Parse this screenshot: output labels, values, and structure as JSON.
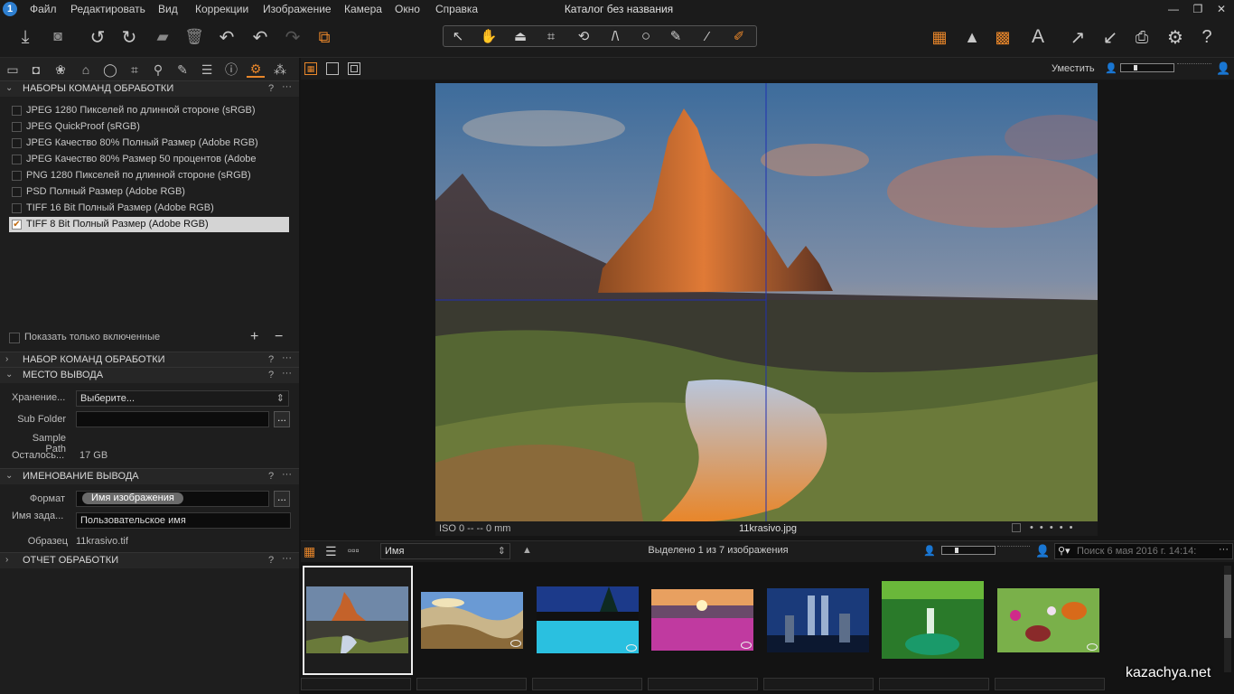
{
  "window": {
    "title": "Каталог без названия"
  },
  "menu": [
    "Файл",
    "Редактировать",
    "Вид",
    "Коррекции",
    "Изображение",
    "Камера",
    "Окно",
    "Справка"
  ],
  "window_controls": [
    "—",
    "❐",
    "✕"
  ],
  "app_icon": "1",
  "toolbar": {
    "left_icons": [
      "import-icon",
      "camera-icon",
      "rotate-left-icon",
      "rotate-right-icon",
      "move-to-icon",
      "trash-icon",
      "undo-all-icon",
      "undo-icon",
      "redo-icon",
      "variants-icon"
    ],
    "cursor_tools": [
      "select-icon",
      "pan-icon",
      "loupe-icon",
      "crop-icon",
      "rotate-icon",
      "keystone-icon",
      "spot-icon",
      "brush-icon",
      "picker-icon",
      "color-picker-icon"
    ],
    "right_icons": [
      "grid-overlay-icon",
      "warning-icon",
      "focus-mask-icon",
      "text-icon",
      "export-icon",
      "import-arrow-icon",
      "print-icon",
      "settings-icon",
      "help-icon"
    ]
  },
  "tooltabs": [
    "folder",
    "camera",
    "color",
    "exposure",
    "lens",
    "crop",
    "loupe",
    "brush",
    "meta",
    "info",
    "output",
    "batch"
  ],
  "sections": {
    "process_recipes": {
      "title": "НАБОРЫ КОМАНД ОБРАБОТКИ",
      "items": [
        {
          "label": "JPEG 1280 Пикселей по длинной стороне (sRGB)",
          "checked": false
        },
        {
          "label": "JPEG QuickProof (sRGB)",
          "checked": false
        },
        {
          "label": "JPEG Качество 80% Полный Размер (Adobe RGB)",
          "checked": false
        },
        {
          "label": "JPEG Качество 80% Размер 50 процентов (Adobe",
          "checked": false
        },
        {
          "label": "PNG 1280 Пикселей по длинной стороне (sRGB)",
          "checked": false
        },
        {
          "label": "PSD Полный Размер (Adobe RGB)",
          "checked": false
        },
        {
          "label": "TIFF 16 Bit Полный Размер (Adobe RGB)",
          "checked": false
        },
        {
          "label": "TIFF 8 Bit Полный Размер (Adobe RGB)",
          "checked": true
        }
      ],
      "show_only_enabled": "Показать только включенные",
      "add": "+",
      "remove": "−"
    },
    "process_recipe": {
      "title": "НАБОР КОМАНД ОБРАБОТКИ"
    },
    "output_location": {
      "title": "МЕСТО ВЫВОДА",
      "storage_label": "Хранение...",
      "storage_value": "Выберите...",
      "subfolder_label": "Sub Folder",
      "subfolder_value": "",
      "sample_path_label": "Sample Path",
      "remaining_label": "Осталось...",
      "remaining_value": "17 GB",
      "browse": "..."
    },
    "output_naming": {
      "title": "ИМЕНОВАНИЕ ВЫВОДА",
      "format_label": "Формат",
      "format_token": "Имя изображения",
      "job_name_label": "Имя зада...",
      "job_name_value": "Пользовательское имя",
      "sample_label": "Образец",
      "sample_value": "11krasivo.tif",
      "browse": "..."
    },
    "process_summary": {
      "title": "ОТЧЕТ ОБРАБОТКИ"
    },
    "help": "?",
    "more": "···"
  },
  "viewer": {
    "fit_label": "Уместить",
    "caption_left": "ISO 0  --  -- 0 mm",
    "caption_center": "11krasivo.jpg",
    "rating_dots": "• • • • •"
  },
  "browser": {
    "sort_label": "Имя",
    "selection_status": "Выделено 1 из 7 изображения",
    "search_placeholder": "Поиск 6 мая 2016 г. 14:14:",
    "thumbnails": [
      {
        "name": "mountain",
        "selected": true
      },
      {
        "name": "valley",
        "selected": false
      },
      {
        "name": "pool",
        "selected": false
      },
      {
        "name": "flowers",
        "selected": false
      },
      {
        "name": "towers",
        "selected": false
      },
      {
        "name": "waterfall",
        "selected": false
      },
      {
        "name": "butterflies",
        "selected": false
      }
    ]
  },
  "watermark": "kazachya.net",
  "colors": {
    "accent": "#e8862a",
    "selection": "#d4d4d4"
  }
}
